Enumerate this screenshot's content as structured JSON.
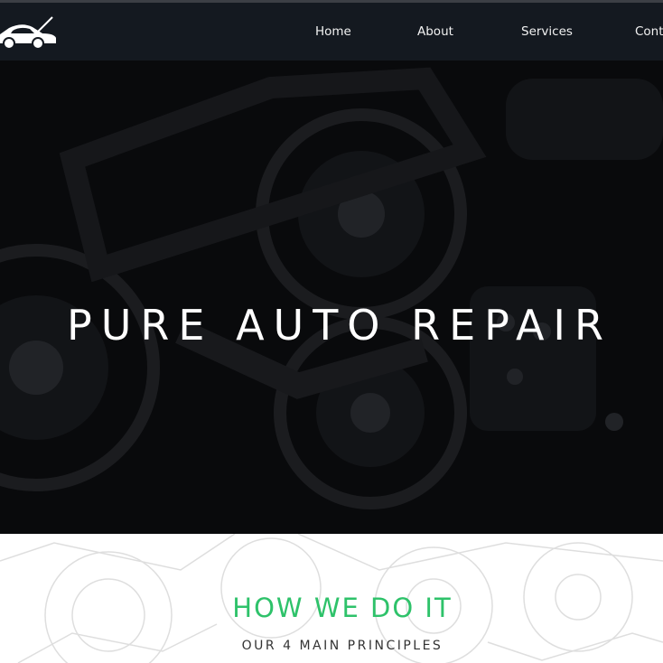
{
  "nav": {
    "logo_icon": "car-icon",
    "links": [
      "Home",
      "About",
      "Services",
      "Cont"
    ]
  },
  "hero": {
    "title": "PURE AUTO REPAIR"
  },
  "principles": {
    "heading": "HOW WE DO IT",
    "subheading": "OUR 4 MAIN PRINCIPLES"
  },
  "colors": {
    "navbar": "#141920",
    "accent": "#2ec26a",
    "hero_overlay": "#0e0f12"
  }
}
